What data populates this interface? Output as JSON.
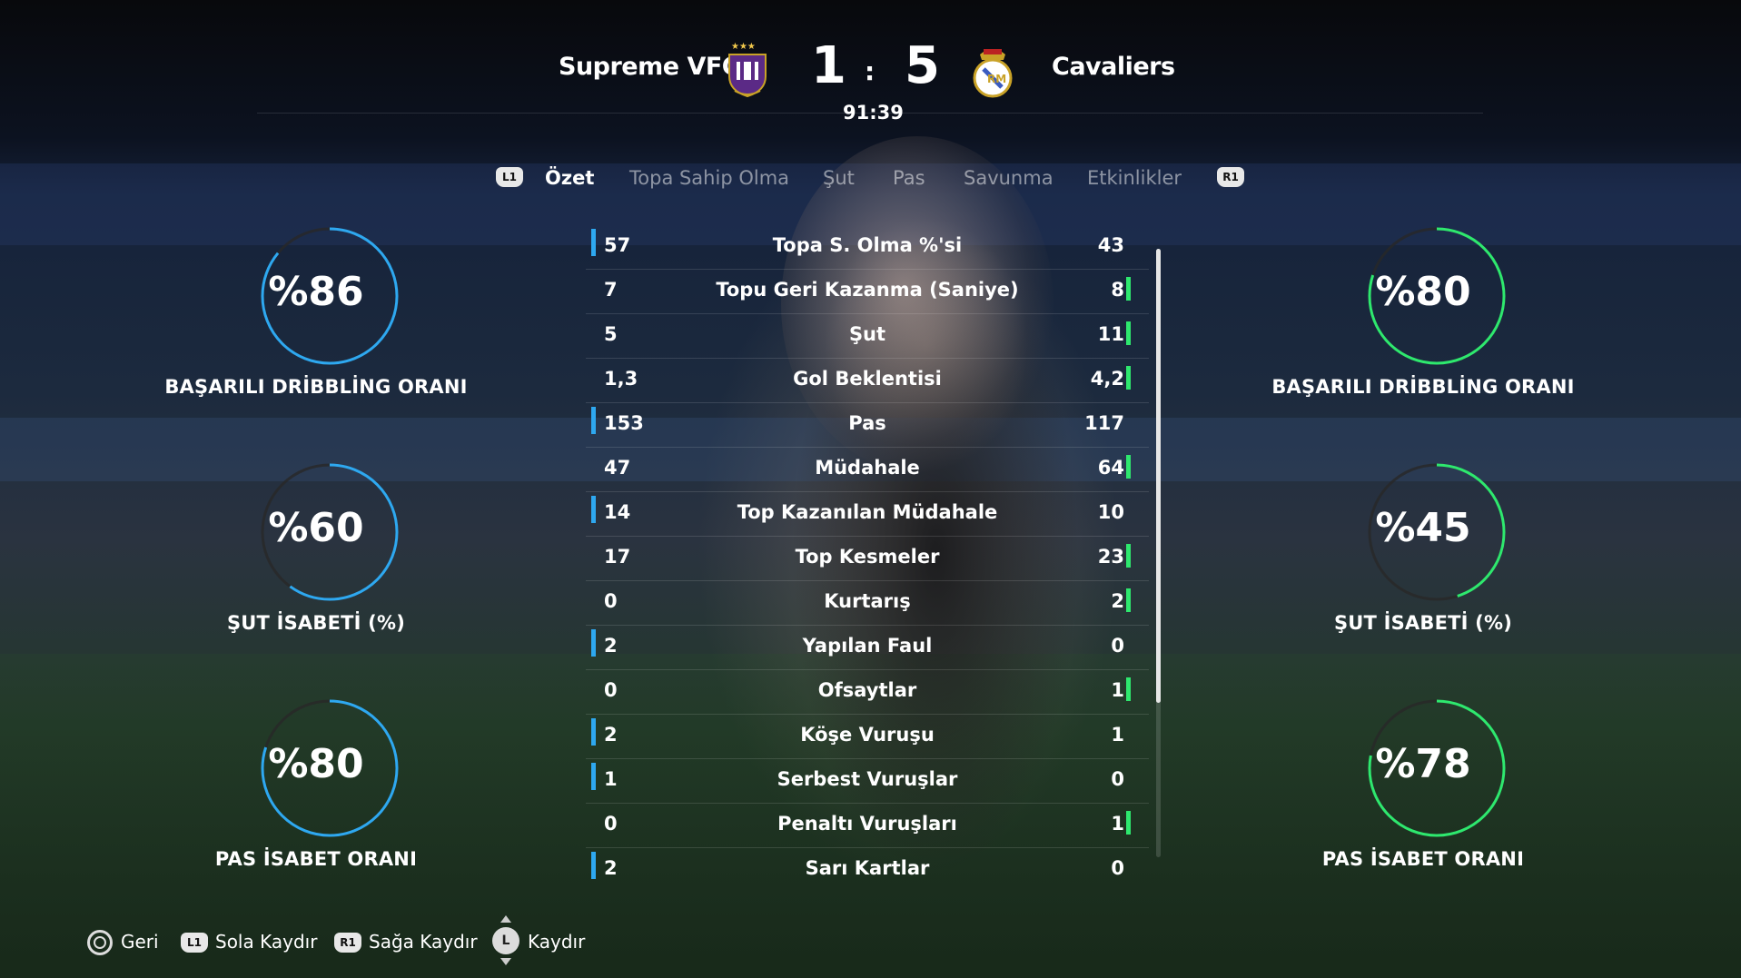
{
  "match": {
    "home_team": "Supreme VFC",
    "away_team": "Cavaliers",
    "home_score": "1",
    "away_score": "5",
    "separator": ":",
    "clock": "91:39"
  },
  "colors": {
    "home": "#2ea8f0",
    "away": "#2ee86e"
  },
  "tabs": {
    "left_button": "L1",
    "right_button": "R1",
    "items": [
      "Özet",
      "Topa Sahip Olma",
      "Şut",
      "Pas",
      "Savunma",
      "Etkinlikler"
    ],
    "active": "Özet"
  },
  "home_rings": [
    {
      "value": 86,
      "text": "%86",
      "label": "BAŞARILI DRİBBLİNG ORANI"
    },
    {
      "value": 60,
      "text": "%60",
      "label": "ŞUT İSABETİ (%)"
    },
    {
      "value": 80,
      "text": "%80",
      "label": "PAS İSABET ORANI"
    }
  ],
  "away_rings": [
    {
      "value": 80,
      "text": "%80",
      "label": "BAŞARILI DRİBBLİNG ORANI"
    },
    {
      "value": 45,
      "text": "%45",
      "label": "ŞUT İSABETİ (%)"
    },
    {
      "value": 78,
      "text": "%78",
      "label": "PAS İSABET ORANI"
    }
  ],
  "stats": [
    {
      "name": "Topa S. Olma %'si",
      "home": "57",
      "away": "43",
      "leader": "home"
    },
    {
      "name": "Topu Geri Kazanma (Saniye)",
      "home": "7",
      "away": "8",
      "leader": "away"
    },
    {
      "name": "Şut",
      "home": "5",
      "away": "11",
      "leader": "away"
    },
    {
      "name": "Gol Beklentisi",
      "home": "1,3",
      "away": "4,2",
      "leader": "away"
    },
    {
      "name": "Pas",
      "home": "153",
      "away": "117",
      "leader": "home"
    },
    {
      "name": "Müdahale",
      "home": "47",
      "away": "64",
      "leader": "away"
    },
    {
      "name": "Top Kazanılan Müdahale",
      "home": "14",
      "away": "10",
      "leader": "home"
    },
    {
      "name": "Top Kesmeler",
      "home": "17",
      "away": "23",
      "leader": "away"
    },
    {
      "name": "Kurtarış",
      "home": "0",
      "away": "2",
      "leader": "away"
    },
    {
      "name": "Yapılan Faul",
      "home": "2",
      "away": "0",
      "leader": "home"
    },
    {
      "name": "Ofsaytlar",
      "home": "0",
      "away": "1",
      "leader": "away"
    },
    {
      "name": "Köşe Vuruşu",
      "home": "2",
      "away": "1",
      "leader": "home"
    },
    {
      "name": "Serbest Vuruşlar",
      "home": "1",
      "away": "0",
      "leader": "home"
    },
    {
      "name": "Penaltı Vuruşları",
      "home": "0",
      "away": "1",
      "leader": "away"
    },
    {
      "name": "Sarı Kartlar",
      "home": "2",
      "away": "0",
      "leader": "home"
    }
  ],
  "footer": {
    "back": "Geri",
    "l1_button": "L1",
    "scroll_left": "Sola Kaydır",
    "r1_button": "R1",
    "scroll_right": "Sağa Kaydır",
    "stick_button": "L",
    "scroll": "Kaydır"
  }
}
